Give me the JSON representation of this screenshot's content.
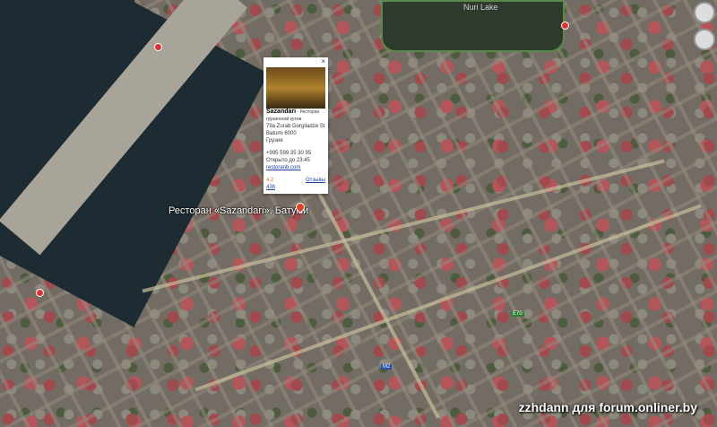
{
  "map": {
    "lake_label": "Nuri Lake",
    "poi_label": "Ресторан «Sazandari», Батуми"
  },
  "popup": {
    "name": "Sazandari",
    "category": " - Ресторан грузинской кухни",
    "address_line1": "79a Zurab Gorgiladze St",
    "address_line2": "Batumi 6000",
    "country": "Грузия",
    "phone": "+995 599 35 30 95",
    "hours": "Открыто до 23:45",
    "website": "restoranb.com",
    "rating": "4.2",
    "reviews_count": "438",
    "reviews_link": "Отзывы",
    "close": "×"
  },
  "routes": [
    "E70",
    "M2"
  ],
  "watermark": "zzhdann для forum.onliner.by"
}
